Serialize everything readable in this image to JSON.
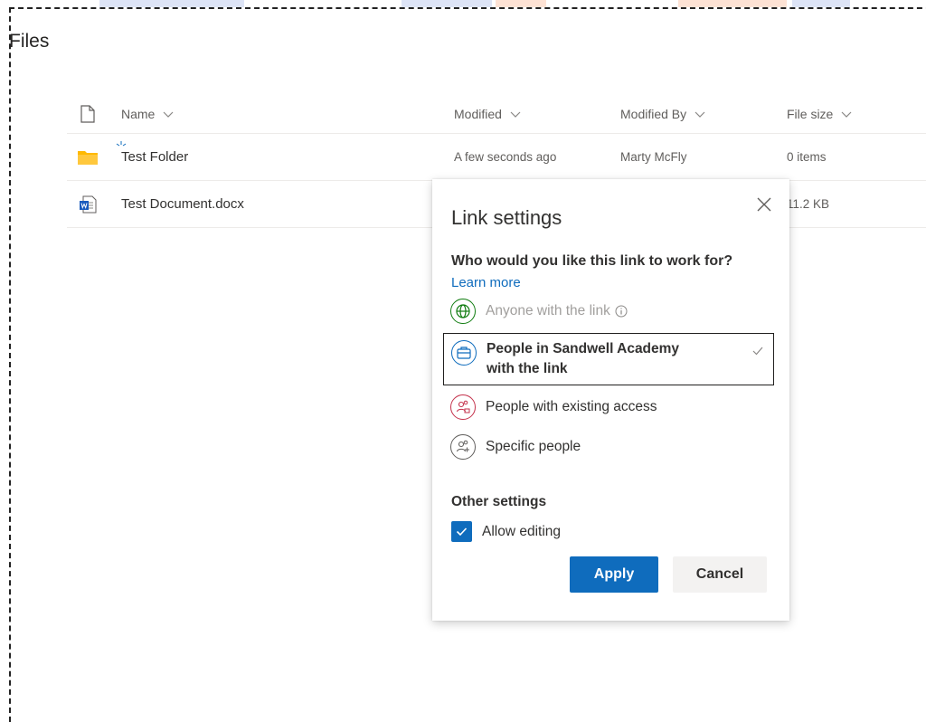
{
  "page": {
    "title": "Files"
  },
  "list": {
    "headers": {
      "name": "Name",
      "modified": "Modified",
      "modified_by": "Modified By",
      "file_size": "File size"
    },
    "rows": [
      {
        "icon": "folder-icon",
        "name": "Test Folder",
        "modified": "A few seconds ago",
        "modified_by": "Marty McFly",
        "file_size": "0 items"
      },
      {
        "icon": "word-document-icon",
        "name": "Test Document.docx",
        "modified": "",
        "modified_by": "",
        "file_size": "11.2 KB"
      }
    ]
  },
  "dialog": {
    "title": "Link settings",
    "question": "Who would you like this link to work for?",
    "learn_more": "Learn more",
    "options": [
      {
        "label": "Anyone with the link",
        "icon": "globe-icon",
        "state": "disabled"
      },
      {
        "label": "People in Sandwell Academy with the link",
        "icon": "organization-icon",
        "state": "selected"
      },
      {
        "label": "People with existing access",
        "icon": "existing-access-icon",
        "state": "normal"
      },
      {
        "label": "Specific people",
        "icon": "specific-people-icon",
        "state": "normal"
      }
    ],
    "other_settings": "Other settings",
    "allow_editing": {
      "label": "Allow editing",
      "checked": true
    },
    "apply": "Apply",
    "cancel": "Cancel"
  },
  "colors": {
    "accent": "#0f6cbd",
    "folder": "#ffb900",
    "globe_green": "#107c10",
    "org_blue": "#0f6cbd",
    "existing_red": "#c4314b",
    "specific_gray": "#605e5c"
  }
}
